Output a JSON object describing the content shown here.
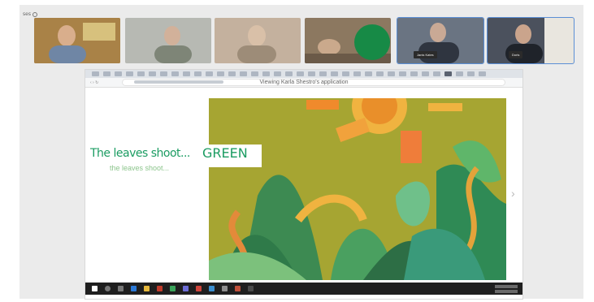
{
  "window": {
    "corner_label": "ses"
  },
  "participants": [
    {
      "name": "",
      "bg": "#8c6a3f"
    },
    {
      "name": "",
      "bg": "#a7a9a4"
    },
    {
      "name": "",
      "bg": "#b29c86"
    },
    {
      "name": "",
      "bg": "#8f7a60"
    },
    {
      "name": "Janis Kates",
      "bg": "#5b6370"
    },
    {
      "name": "Doris",
      "bg": "#3e4450"
    }
  ],
  "shared_screen": {
    "banner": "Viewing Karla Shestro's application",
    "slide": {
      "line1": "The leaves shoot...",
      "line1_emphasis": "GREEN",
      "line2": "the leaves shoot..."
    },
    "colors": {
      "accent": "#1b9c62",
      "art_bg": "#a6a532",
      "green_dot": "#178a46"
    }
  },
  "icons": [
    "settings-ring-icon",
    "next-arrow-icon",
    "windows-start-icon"
  ]
}
